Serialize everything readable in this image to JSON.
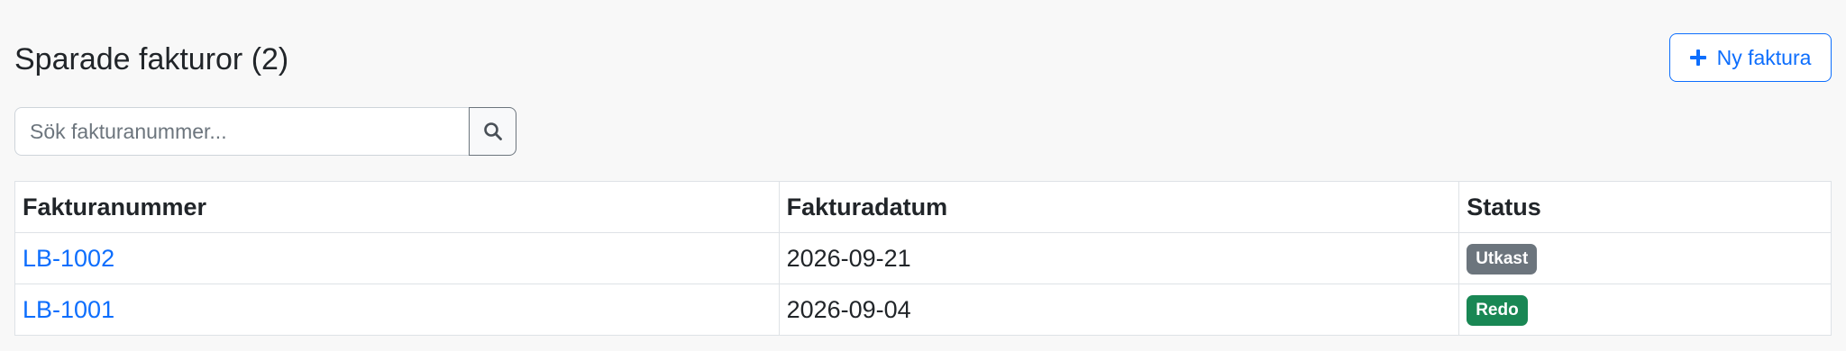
{
  "header": {
    "title": "Sparade fakturor (2)",
    "new_button_label": "Ny faktura"
  },
  "search": {
    "placeholder": "Sök fakturanummer...",
    "value": "",
    "button_icon": "search-icon"
  },
  "table": {
    "columns": [
      "Fakturanummer",
      "Fakturadatum",
      "Status"
    ],
    "rows": [
      {
        "number": "LB-1002",
        "date": "2026-09-21",
        "status": "Utkast",
        "status_color": "#6c757d"
      },
      {
        "number": "LB-1001",
        "date": "2026-09-04",
        "status": "Redo",
        "status_color": "#198754"
      }
    ]
  },
  "colors": {
    "accent": "#0d6efd",
    "badge_draft": "#6c757d",
    "badge_ready": "#198754"
  }
}
